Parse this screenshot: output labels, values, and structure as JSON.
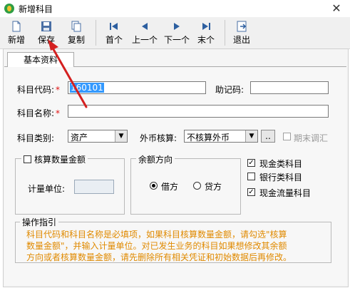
{
  "window": {
    "title": "新增科目",
    "close": "✕"
  },
  "toolbar": {
    "new_label": "新增",
    "save_label": "保存",
    "copy_label": "复制",
    "first_label": "首个",
    "prev_label": "上一个",
    "next_label": "下一个",
    "last_label": "末个",
    "exit_label": "退出"
  },
  "tabs": {
    "basic": "基本资料"
  },
  "form": {
    "code_label": "科目代码:",
    "code_value": "160101",
    "mnemonic_label": "助记码:",
    "mnemonic_value": "",
    "name_label": "科目名称:",
    "name_value": "",
    "required_mark": "*",
    "type_label": "科目类别:",
    "type_value": "资产",
    "currency_label": "外币核算:",
    "currency_value": "不核算外币",
    "currency_button": "..",
    "period_adjust_label": "期末调汇",
    "qty_group_label": "核算数量金额",
    "unit_label": "计量单位:",
    "unit_value": "",
    "balance_group_label": "余额方向",
    "debit_label": "借方",
    "credit_label": "贷方",
    "cash_label": "现金类科目",
    "bank_label": "银行类科目",
    "cashflow_label": "现金流量科目"
  },
  "guide": {
    "title": "操作指引",
    "line1": "科目代码和科目名称是必填项，如果科目核算数量金额，请勾选\"核算",
    "line2": "数量金额\"，并输入计量单位。对已发生业务的科目如果想修改其余额",
    "line3": "方向或者核算数量金额，请先删除所有相关凭证和初始数据后再修改。"
  },
  "colors": {
    "accent_red": "#e01010",
    "selection": "#3399ff",
    "guide_text": "#e08a00",
    "annotation_arrow": "#d42020"
  }
}
